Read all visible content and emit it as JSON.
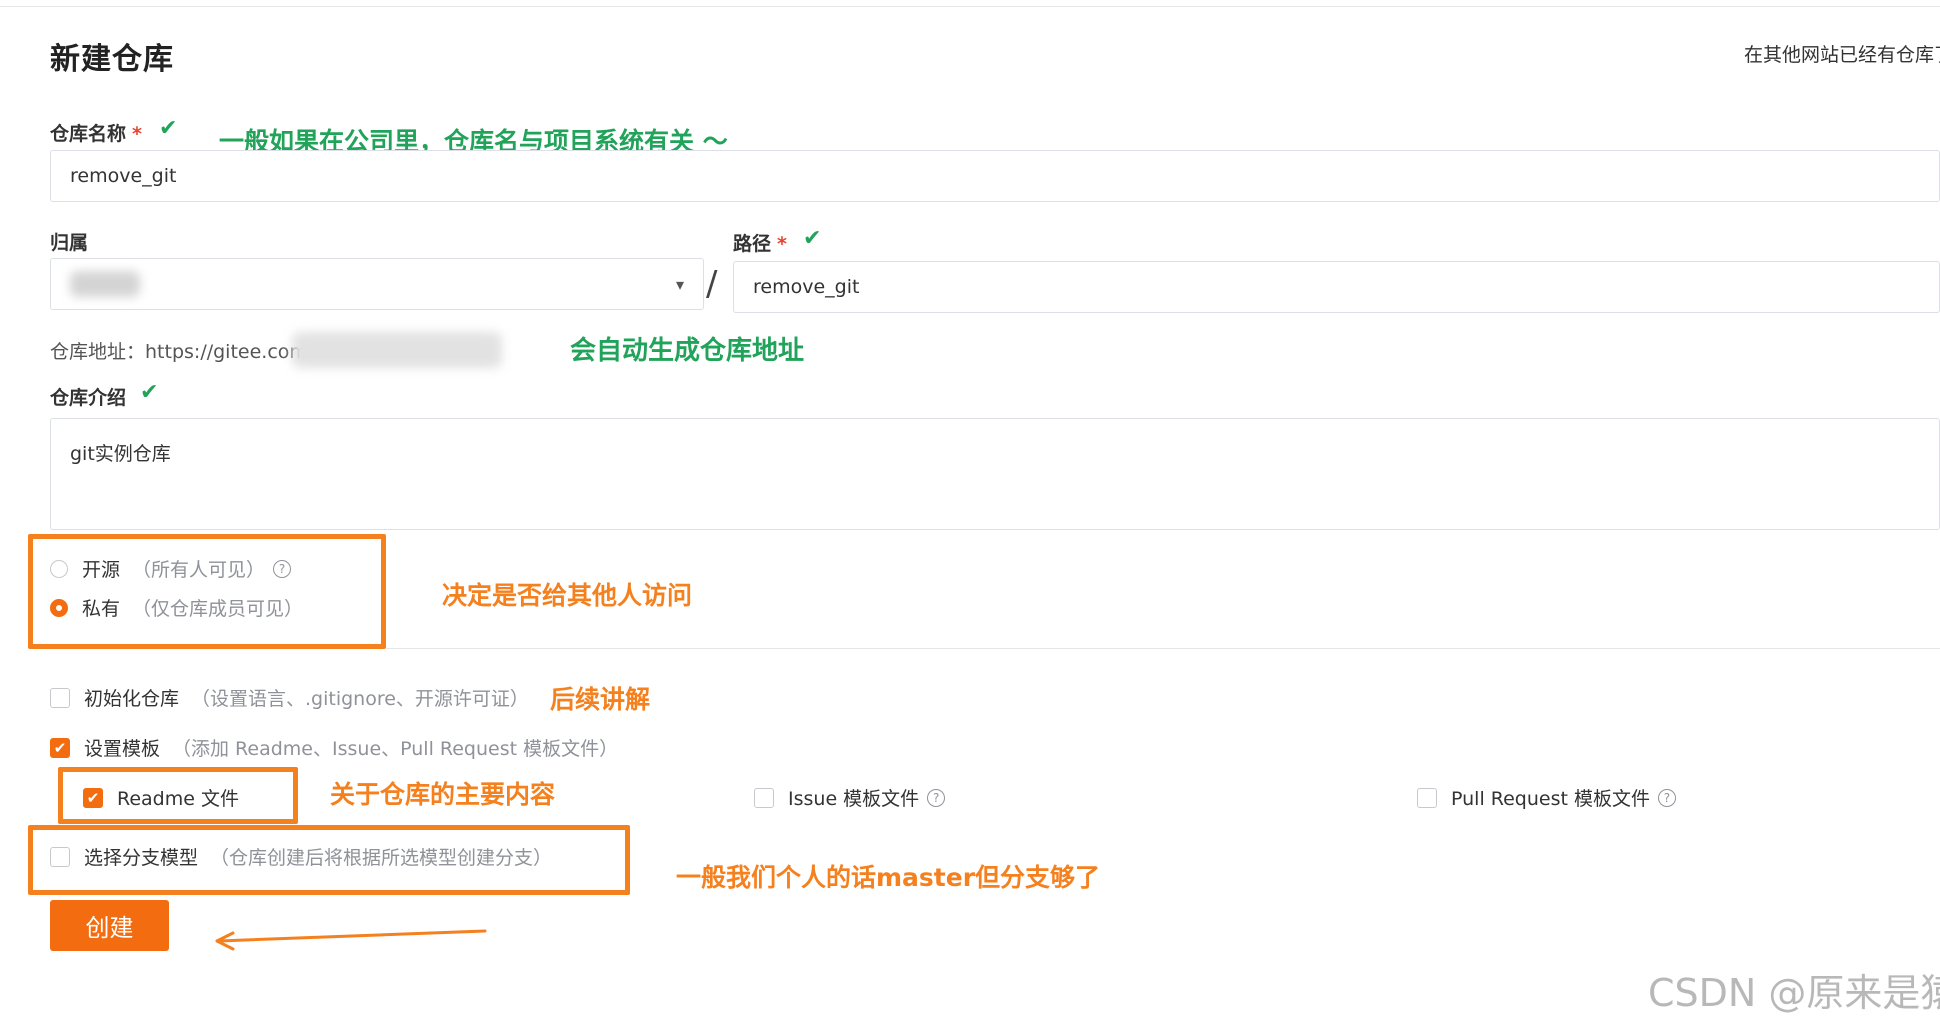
{
  "page": {
    "title": "新建仓库",
    "import_link": "在其他网站已经有仓库了"
  },
  "repo_name": {
    "label": "仓库名称",
    "required_mark": "*",
    "value": "remove_git",
    "annotation": "一般如果在公司里，仓库名与项目系统有关 ～"
  },
  "owner": {
    "label": "归属",
    "separator": "/"
  },
  "path": {
    "label": "路径",
    "required_mark": "*",
    "value": "remove_git"
  },
  "repo_address": {
    "label": "仓库地址：",
    "value": "https://gitee.com",
    "annotation": "会自动生成仓库地址"
  },
  "description": {
    "label": "仓库介绍",
    "value": "git实例仓库"
  },
  "visibility": {
    "options": [
      {
        "label": "开源",
        "hint": "（所有人可见）",
        "selected": false
      },
      {
        "label": "私有",
        "hint": "（仅仓库成员可见）",
        "selected": true
      }
    ],
    "annotation": "决定是否给其他人访问"
  },
  "init_repo": {
    "label": "初始化仓库",
    "hint": "（设置语言、.gitignore、开源许可证）",
    "checked": false,
    "annotation": "后续讲解"
  },
  "template": {
    "label": "设置模板",
    "hint": "（添加 Readme、Issue、Pull Request 模板文件）",
    "checked": true,
    "items": [
      {
        "label": "Readme 文件",
        "checked": true
      },
      {
        "label": "Issue 模板文件",
        "checked": false
      },
      {
        "label": "Pull Request 模板文件",
        "checked": false
      }
    ],
    "annotation": "关于仓库的主要内容"
  },
  "branch_model": {
    "label": "选择分支模型",
    "hint": "（仓库创建后将根据所选模型创建分支）",
    "checked": false,
    "annotation": "一般我们个人的话master但分支够了"
  },
  "create_button": {
    "label": "创建"
  },
  "icons": {
    "check": "✔",
    "help": "?",
    "chevron": "▾",
    "checkbox_tick": "✔"
  },
  "colors": {
    "accent": "#f36d10",
    "annotation_green": "#21a35a",
    "annotation_orange": "#f5801e"
  },
  "watermark": "CSDN @原来是猿"
}
